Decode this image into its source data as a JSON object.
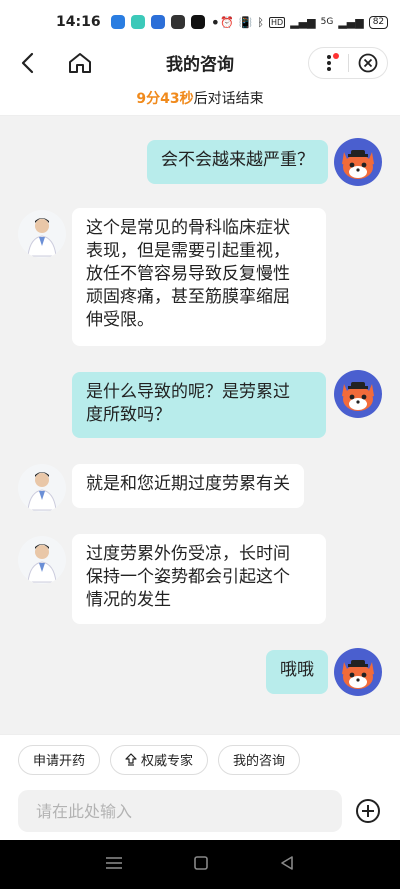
{
  "status_bar": {
    "time": "14:16",
    "network": "5G",
    "battery": "82"
  },
  "header": {
    "title": "我的咨询",
    "icons": [
      "chevron-left-icon",
      "home-icon",
      "more-dots-icon",
      "close-circle-icon"
    ]
  },
  "countdown": {
    "time": "9分43秒",
    "suffix": "后对话结束"
  },
  "messages": [
    {
      "side": "right",
      "sender": "user",
      "text": "会不会越来越严重？"
    },
    {
      "side": "left",
      "sender": "doctor",
      "lines": [
        "这个是常见的骨科临床症状",
        "表现，但是需要引起重视，",
        "放任不管容易导致反复慢性",
        "顽固疼痛，甚至筋膜挛缩屈",
        "伸受限。"
      ]
    },
    {
      "side": "right",
      "sender": "user",
      "lines": [
        "是什么导致的呢？是劳累过",
        "度所致吗？"
      ]
    },
    {
      "side": "left",
      "sender": "doctor",
      "text": "就是和您近期过度劳累有关"
    },
    {
      "side": "left",
      "sender": "doctor",
      "lines": [
        "过度劳累外伤受凉，长时间",
        "保持一个姿势都会引起这个",
        "情况的发生"
      ]
    },
    {
      "side": "right",
      "sender": "user",
      "text": "哦哦"
    }
  ],
  "quick_actions": [
    {
      "label": "申请开药"
    },
    {
      "label": "权威专家",
      "icon": "upload-arrow-icon"
    },
    {
      "label": "我的咨询"
    }
  ],
  "input": {
    "placeholder": "请在此处输入"
  },
  "colors": {
    "accent_orange": "#f08a1c",
    "user_bubble": "#b8eceb",
    "fox_bg": "#4a5fcf"
  }
}
